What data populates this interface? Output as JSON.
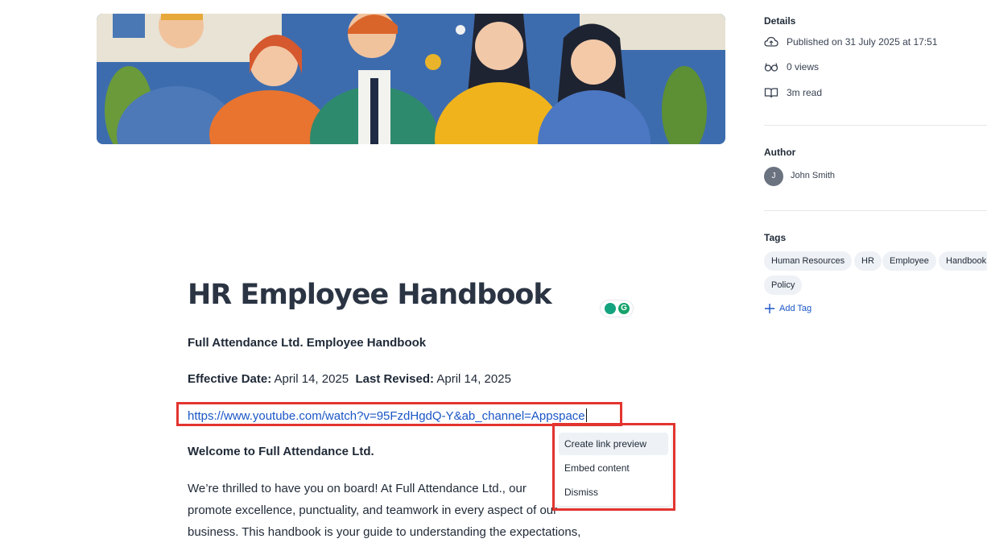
{
  "article": {
    "title": "HR Employee Handbook",
    "subtitle": "Full Attendance Ltd. Employee Handbook",
    "effective_label": "Effective Date:",
    "effective_value": "April 14, 2025",
    "revised_label": "Last Revised:",
    "revised_value": "April 14, 2025",
    "link_url": "https://www.youtube.com/watch?v=95FzdHgdQ-Y&ab_channel=Appspace",
    "welcome": "Welcome to Full Attendance Ltd.",
    "body_line1": "We’re thrilled to have you on board! At Full Attendance Ltd., our",
    "body_line2": "promote excellence, punctuality, and teamwork in every aspect of our",
    "body_line3": "business. This handbook is your guide to understanding the expectations,"
  },
  "link_popup": {
    "items": [
      "Create link preview",
      "Embed content",
      "Dismiss"
    ]
  },
  "sidebar": {
    "details_heading": "Details",
    "published": "Published on 31 July 2025 at 17:51",
    "views": "0 views",
    "read_time": "3m read",
    "author_heading": "Author",
    "author_initial": "J",
    "author_name": "John Smith",
    "tags_heading": "Tags",
    "tags": [
      "Human Resources",
      "HR",
      "Employee",
      "Handbook",
      "Policy"
    ],
    "add_tag": "Add Tag"
  },
  "icons": {
    "published": "cloud-icon",
    "views": "glasses-icon",
    "read": "book-icon",
    "add": "plus-icon"
  },
  "colors": {
    "link": "#1a56c6",
    "highlight": "#e3342f",
    "tag_bg": "#eef1f5"
  }
}
